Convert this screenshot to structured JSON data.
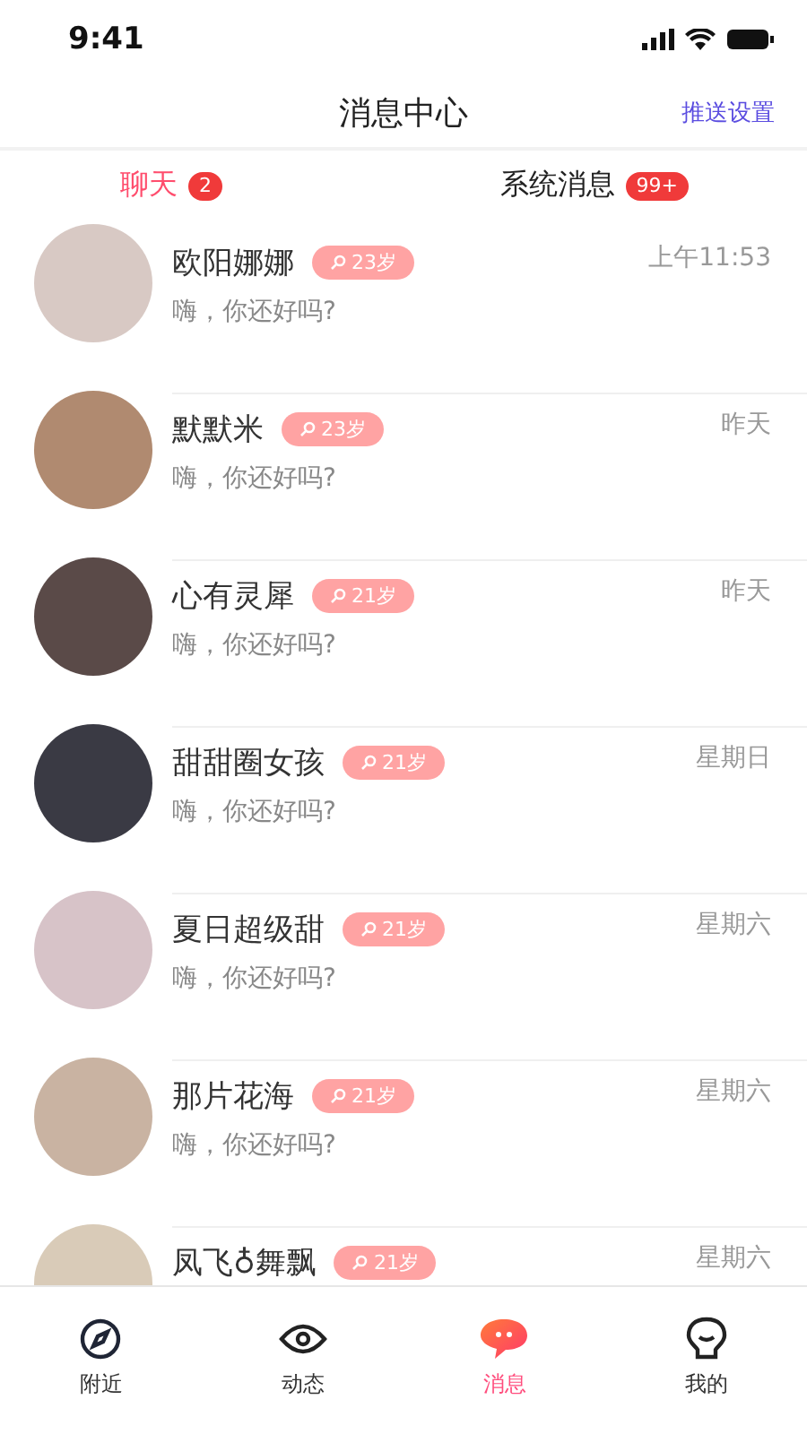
{
  "status_bar": {
    "time": "9:41"
  },
  "header": {
    "title": "消息中心",
    "action": "推送设置"
  },
  "tabs": [
    {
      "label": "聊天",
      "badge": "2",
      "selected": true
    },
    {
      "label": "系统消息",
      "badge": "99+",
      "selected": false
    }
  ],
  "chats": [
    {
      "name": "欧阳娜娜",
      "age": "23岁",
      "message": "嗨，你还好吗?",
      "time": "上午11:53"
    },
    {
      "name": "默默米",
      "age": "23岁",
      "message": "嗨，你还好吗?",
      "time": "昨天"
    },
    {
      "name": "心有灵犀",
      "age": "21岁",
      "message": "嗨，你还好吗?",
      "time": "昨天"
    },
    {
      "name": "甜甜圈女孩",
      "age": "21岁",
      "message": "嗨，你还好吗?",
      "time": "星期日"
    },
    {
      "name": "夏日超级甜",
      "age": "21岁",
      "message": "嗨，你还好吗?",
      "time": "星期六"
    },
    {
      "name": "那片花海",
      "age": "21岁",
      "message": "嗨，你还好吗?",
      "time": "星期六"
    },
    {
      "name": "凤飞♁舞飘",
      "age": "21岁",
      "time": "星期六"
    }
  ],
  "nav": [
    {
      "label": "附近",
      "kind": "compass",
      "selected": false
    },
    {
      "label": "动态",
      "kind": "eye",
      "selected": false
    },
    {
      "label": "消息",
      "kind": "chat",
      "selected": true
    },
    {
      "label": "我的",
      "kind": "face",
      "selected": false
    }
  ]
}
